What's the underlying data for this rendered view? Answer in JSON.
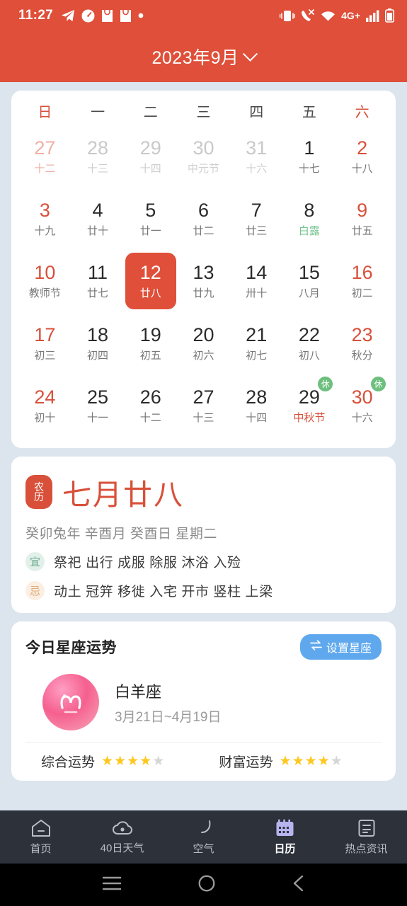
{
  "status_bar": {
    "time": "11:27",
    "network": "4G+",
    "left_icons": [
      "telegram-icon",
      "speedometer-icon",
      "shopping-bag-icon",
      "shopping-bag-icon",
      "dot-icon"
    ],
    "right_icons": [
      "vibrate-icon",
      "call-mute-icon",
      "wifi-icon",
      "signal-icon",
      "battery-icon"
    ]
  },
  "header": {
    "title": "2023年9月",
    "chevron": "chevron-down-icon",
    "bg_color": "#df4f39"
  },
  "calendar": {
    "weekdays": [
      "日",
      "一",
      "二",
      "三",
      "四",
      "五",
      "六"
    ],
    "weeks": [
      [
        {
          "day": "27",
          "lunar": "十二",
          "out": true,
          "red": true
        },
        {
          "day": "28",
          "lunar": "十三",
          "out": true
        },
        {
          "day": "29",
          "lunar": "十四",
          "out": true
        },
        {
          "day": "30",
          "lunar": "中元节",
          "out": true,
          "festival": true
        },
        {
          "day": "31",
          "lunar": "十六",
          "out": true
        },
        {
          "day": "1",
          "lunar": "十七"
        },
        {
          "day": "2",
          "lunar": "十八",
          "red": true
        }
      ],
      [
        {
          "day": "3",
          "lunar": "十九",
          "red": true
        },
        {
          "day": "4",
          "lunar": "廿十"
        },
        {
          "day": "5",
          "lunar": "廿一"
        },
        {
          "day": "6",
          "lunar": "廿二"
        },
        {
          "day": "7",
          "lunar": "廿三"
        },
        {
          "day": "8",
          "lunar": "白露",
          "term": true
        },
        {
          "day": "9",
          "lunar": "廿五",
          "red": true
        }
      ],
      [
        {
          "day": "10",
          "lunar": "教师节",
          "red": true,
          "festival": true
        },
        {
          "day": "11",
          "lunar": "廿七"
        },
        {
          "day": "12",
          "lunar": "廿八",
          "selected": true
        },
        {
          "day": "13",
          "lunar": "廿九"
        },
        {
          "day": "14",
          "lunar": "卅十"
        },
        {
          "day": "15",
          "lunar": "八月"
        },
        {
          "day": "16",
          "lunar": "初二",
          "red": true
        }
      ],
      [
        {
          "day": "17",
          "lunar": "初三",
          "red": true
        },
        {
          "day": "18",
          "lunar": "初四"
        },
        {
          "day": "19",
          "lunar": "初五"
        },
        {
          "day": "20",
          "lunar": "初六"
        },
        {
          "day": "21",
          "lunar": "初七"
        },
        {
          "day": "22",
          "lunar": "初八"
        },
        {
          "day": "23",
          "lunar": "秋分",
          "red": true,
          "term": true
        }
      ],
      [
        {
          "day": "24",
          "lunar": "初十",
          "red": true
        },
        {
          "day": "25",
          "lunar": "十一"
        },
        {
          "day": "26",
          "lunar": "十二"
        },
        {
          "day": "27",
          "lunar": "十三"
        },
        {
          "day": "28",
          "lunar": "十四"
        },
        {
          "day": "29",
          "lunar": "中秋节",
          "festival": true,
          "rest": "休"
        },
        {
          "day": "30",
          "lunar": "十六",
          "red": true,
          "rest": "休"
        }
      ]
    ]
  },
  "lunar_card": {
    "seal_top": "农",
    "seal_bottom": "历",
    "lunar_date": "七月廿八",
    "ganzhi": "癸卯兔年 辛酉月 癸酉日 星期二",
    "yi_label": "宜",
    "yi_text": "祭祀 出行 成服 除服 沐浴 入殓",
    "ji_label": "忌",
    "ji_text": "动土 冠笄 移徙 入宅 开市 竖柱 上梁"
  },
  "horoscope": {
    "title": "今日星座运势",
    "set_button": "设置星座",
    "set_button_icon": "swap-icon",
    "zodiac_name": "白羊座",
    "zodiac_range": "3月21日~4月19日",
    "zodiac_symbol": "aries-icon",
    "fortunes": [
      {
        "label": "综合运势",
        "stars": 4,
        "max": 5
      },
      {
        "label": "财富运势",
        "stars": 4,
        "max": 5
      }
    ]
  },
  "tabbar": {
    "items": [
      {
        "label": "首页",
        "icon": "home-icon",
        "active": false
      },
      {
        "label": "40日天气",
        "icon": "cloud-icon",
        "active": false
      },
      {
        "label": "空气",
        "icon": "leaf-icon",
        "active": false
      },
      {
        "label": "日历",
        "icon": "calendar-icon",
        "active": true
      },
      {
        "label": "热点资讯",
        "icon": "news-icon",
        "active": false
      }
    ],
    "active_color": "#b7b3ef"
  },
  "nav_bar": {
    "items": [
      "recents-icon",
      "home-circle-icon",
      "back-icon"
    ]
  }
}
